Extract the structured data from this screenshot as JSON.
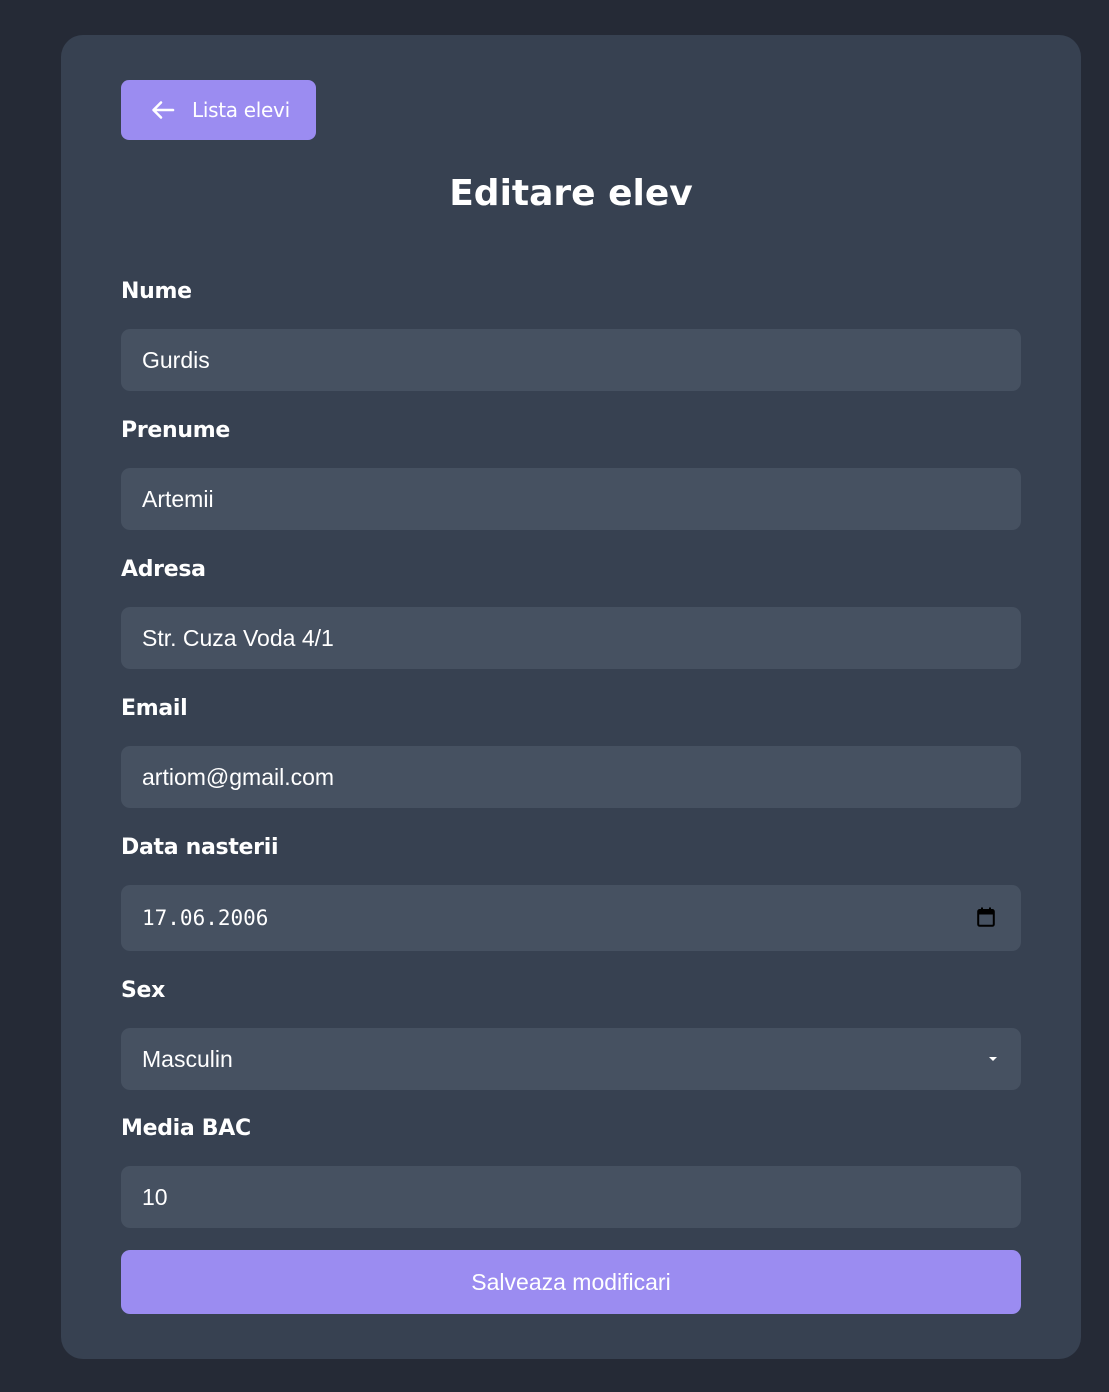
{
  "back_button": {
    "label": "Lista elevi",
    "icon": "arrow-left-icon"
  },
  "page_title": "Editare elev",
  "fields": {
    "nume": {
      "label": "Nume",
      "value": "Gurdis"
    },
    "prenume": {
      "label": "Prenume",
      "value": "Artemii"
    },
    "adresa": {
      "label": "Adresa",
      "value": "Str. Cuza Voda 4/1"
    },
    "email": {
      "label": "Email",
      "value": "artiom@gmail.com"
    },
    "data_nasterii": {
      "label": "Data nasterii",
      "value": "17.06.2006",
      "icon": "calendar-icon"
    },
    "sex": {
      "label": "Sex",
      "value": "Masculin",
      "icon": "chevron-down-icon"
    },
    "media_bac": {
      "label": "Media BAC",
      "value": "10"
    }
  },
  "save_button": {
    "label": "Salveaza modificari"
  },
  "colors": {
    "page_background": "#252a36",
    "card_background": "#374151",
    "input_background": "#465161",
    "accent": "#9b8cf1",
    "text": "#ffffff"
  }
}
